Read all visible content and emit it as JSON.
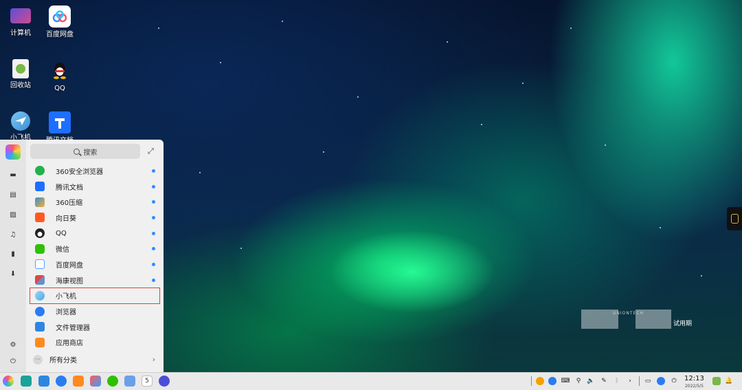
{
  "desktop": {
    "icons": [
      {
        "label": "计算机",
        "icon": "computer-icon"
      },
      {
        "label": "百度网盘",
        "icon": "baidu-netdisk-icon"
      },
      {
        "label": "回收站",
        "icon": "trash-icon"
      },
      {
        "label": "QQ",
        "icon": "qq-icon"
      },
      {
        "label": "小飞机",
        "icon": "paper-plane-icon"
      },
      {
        "label": "腾讯文档",
        "icon": "tencent-docs-icon"
      }
    ]
  },
  "start_menu": {
    "search_placeholder": "搜索",
    "apps": [
      {
        "label": "360安全浏览器",
        "icon": "360-browser-icon",
        "color": "#22b14c",
        "new": true
      },
      {
        "label": "腾讯文档",
        "icon": "tencent-docs-icon",
        "color": "#1e6fff",
        "new": true
      },
      {
        "label": "360压缩",
        "icon": "360-zip-icon",
        "color": "#3a8ad8",
        "new": true
      },
      {
        "label": "向日葵",
        "icon": "sunflower-icon",
        "color": "#ff5a1f",
        "new": true
      },
      {
        "label": "QQ",
        "icon": "qq-icon",
        "color": "#222222",
        "new": true
      },
      {
        "label": "微信",
        "icon": "wechat-icon",
        "color": "#2dc100",
        "new": true
      },
      {
        "label": "百度网盘",
        "icon": "baidu-netdisk-icon",
        "color": "#4aa3ff",
        "new": true
      },
      {
        "label": "海康视图",
        "icon": "hikvision-icon",
        "color": "#d94a4a",
        "new": true
      },
      {
        "label": "小飞机",
        "icon": "paper-plane-icon",
        "color": "#4fa8e6",
        "new": false
      },
      {
        "label": "浏览器",
        "icon": "browser-icon",
        "color": "#2a7cf2",
        "new": false
      },
      {
        "label": "文件管理器",
        "icon": "file-manager-icon",
        "color": "#2f86e0",
        "new": false
      },
      {
        "label": "应用商店",
        "icon": "app-store-icon",
        "color": "#ff8a1f",
        "new": false
      }
    ],
    "all_categories": "所有分类"
  },
  "watermark": {
    "brand": "UNIONTECH",
    "trial": "试用期"
  },
  "taskbar": {
    "time": "12:13",
    "date": "2022/5/5"
  }
}
